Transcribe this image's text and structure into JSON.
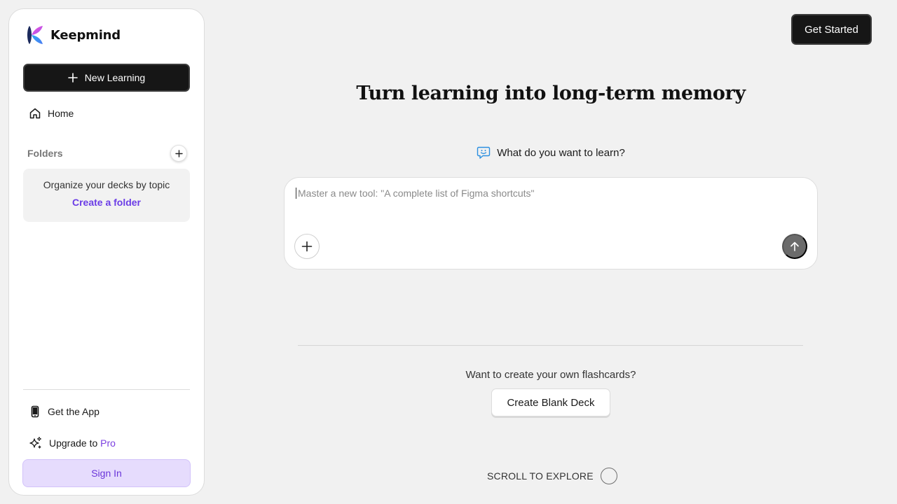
{
  "app": {
    "name": "Keepmind",
    "logo_icon": "keepmind-logo-icon",
    "colors": {
      "accent_purple": "#6b3de6",
      "dark_button": "#161616",
      "signin_bg": "#e6dcfd",
      "background": "#f1f1f1"
    }
  },
  "sidebar": {
    "new_button_label": "New Learning",
    "new_button_icon": "plus-icon",
    "home_label": "Home",
    "home_icon": "home-icon",
    "folders_title": "Folders",
    "folder_add_icon": "plus-icon",
    "folder_hint": "Organize your decks by topic",
    "create_folder_label": "Create a folder",
    "get_app_label": "Get the App",
    "get_app_icon": "smartphone-icon",
    "upgrade_prefix": "Upgrade to ",
    "upgrade_highlight": "Pro",
    "upgrade_icon": "sparkles-icon",
    "signin_label": "Sign In"
  },
  "header": {
    "get_started_label": "Get Started"
  },
  "main": {
    "headline": "Turn learning into long-term memory",
    "ask_label": "What do you want to learn?",
    "ask_icon": "chat-smile-icon",
    "prompt": {
      "value": "",
      "placeholder": "Master a new tool: \"A complete list of Figma shortcuts\"",
      "attach_icon": "plus-icon",
      "send_icon": "arrow-up-icon"
    },
    "own_cards_text": "Want to create your own flashcards?",
    "blank_deck_label": "Create Blank Deck",
    "scroll_label": "SCROLL TO EXPLORE"
  }
}
